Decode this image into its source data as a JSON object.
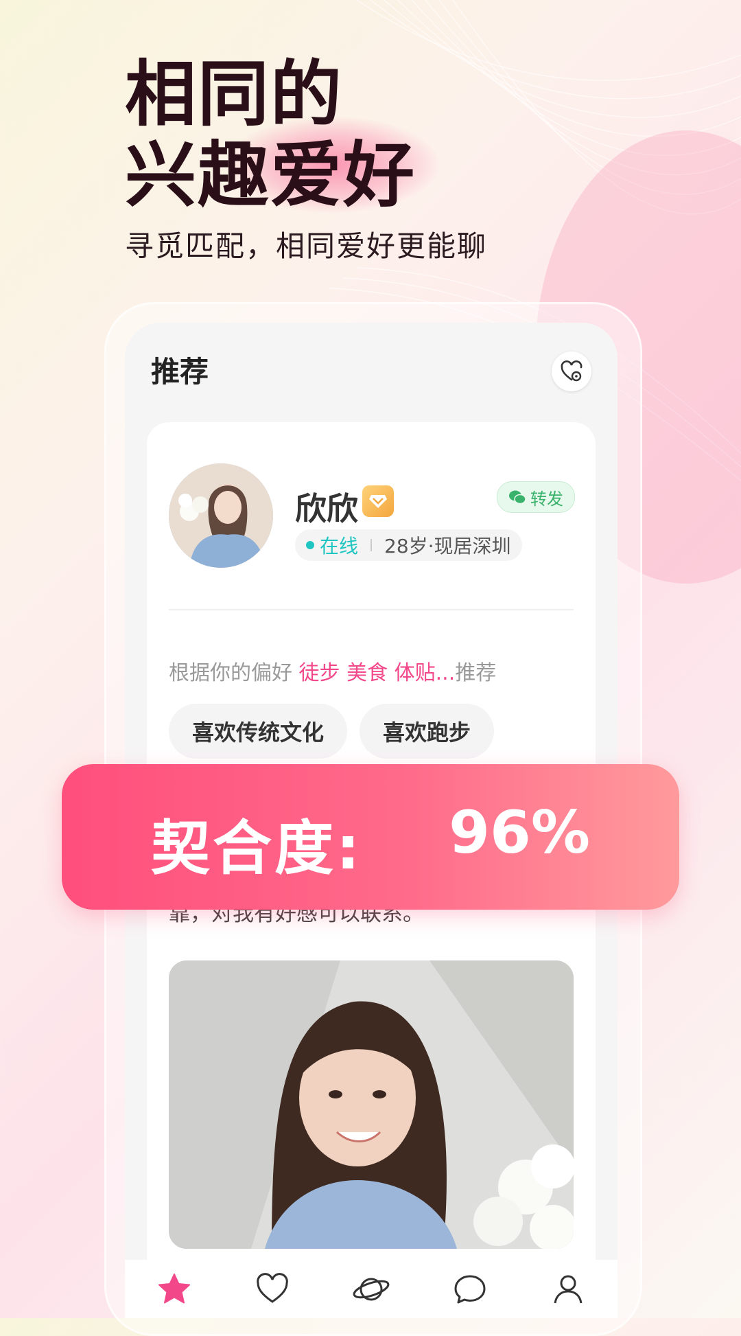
{
  "promo": {
    "headline_line1": "相同的",
    "headline_line2": "兴趣爱好",
    "subline": "寻觅匹配，相同爱好更能聊"
  },
  "screen": {
    "title": "推荐",
    "profile": {
      "name": "欣欣",
      "share_label": "转发",
      "status": "在线",
      "info": "28岁·现居深圳"
    },
    "preference": {
      "prefix": "根据你的偏好",
      "highlights": "徒步 美食 体贴...",
      "suffix": "推荐"
    },
    "tags": [
      "喜欢传统文化",
      "喜欢跑步"
    ],
    "intro_text": "靠，对我有好感可以联系。"
  },
  "match": {
    "label": "契合度:",
    "value": "96%"
  },
  "tabbar": {
    "items": [
      "star-icon",
      "heart-icon",
      "planet-icon",
      "chat-icon",
      "profile-icon"
    ],
    "active_color": "#f2488a",
    "inactive_color": "#333333"
  }
}
